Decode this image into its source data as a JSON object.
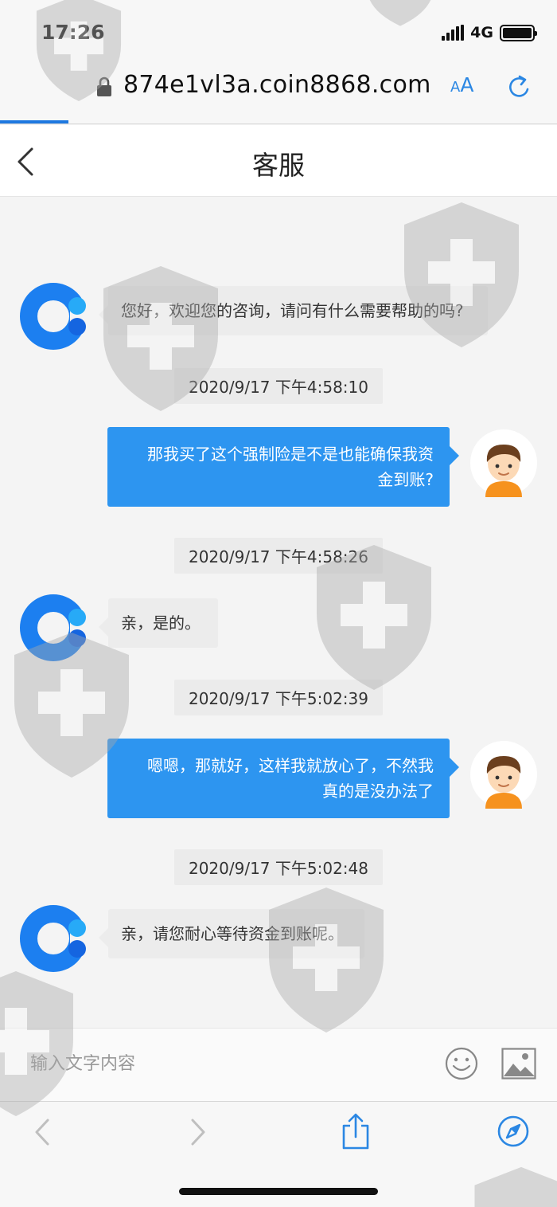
{
  "status_bar": {
    "time": "17:26",
    "network": "4G"
  },
  "browser": {
    "url": "874e1vl3a.coin8868.com",
    "text_size_label_small": "A",
    "text_size_label_large": "A"
  },
  "chat": {
    "title": "客服",
    "messages": [
      {
        "from": "agent",
        "text": "您好，欢迎您的咨询，请问有什么需要帮助的吗?"
      },
      {
        "timestamp": "2020/9/17 下午4:58:10"
      },
      {
        "from": "user",
        "lines": [
          "那我买了这个强制险是不是也能确保我资",
          "金到账?"
        ]
      },
      {
        "timestamp": "2020/9/17 下午4:58:26"
      },
      {
        "from": "agent",
        "text": "亲，是的。"
      },
      {
        "timestamp": "2020/9/17 下午5:02:39"
      },
      {
        "from": "user",
        "lines": [
          "嗯嗯，那就好，这样我就放心了，不然我",
          "真的是没办法了"
        ]
      },
      {
        "timestamp": "2020/9/17 下午5:02:48"
      },
      {
        "from": "agent",
        "text": "亲，请您耐心等待资金到账呢。"
      }
    ]
  },
  "input": {
    "placeholder": "输入文字内容"
  },
  "icons": {
    "back": "chevron-left-icon",
    "lock": "lock-icon",
    "reload": "reload-icon",
    "emoji": "smiley-icon",
    "image": "image-icon",
    "share": "share-icon",
    "compass": "compass-icon"
  },
  "colors": {
    "accent": "#2d95f0",
    "agent_bubble": "#ececec",
    "safari_blue": "#2b87e3"
  }
}
